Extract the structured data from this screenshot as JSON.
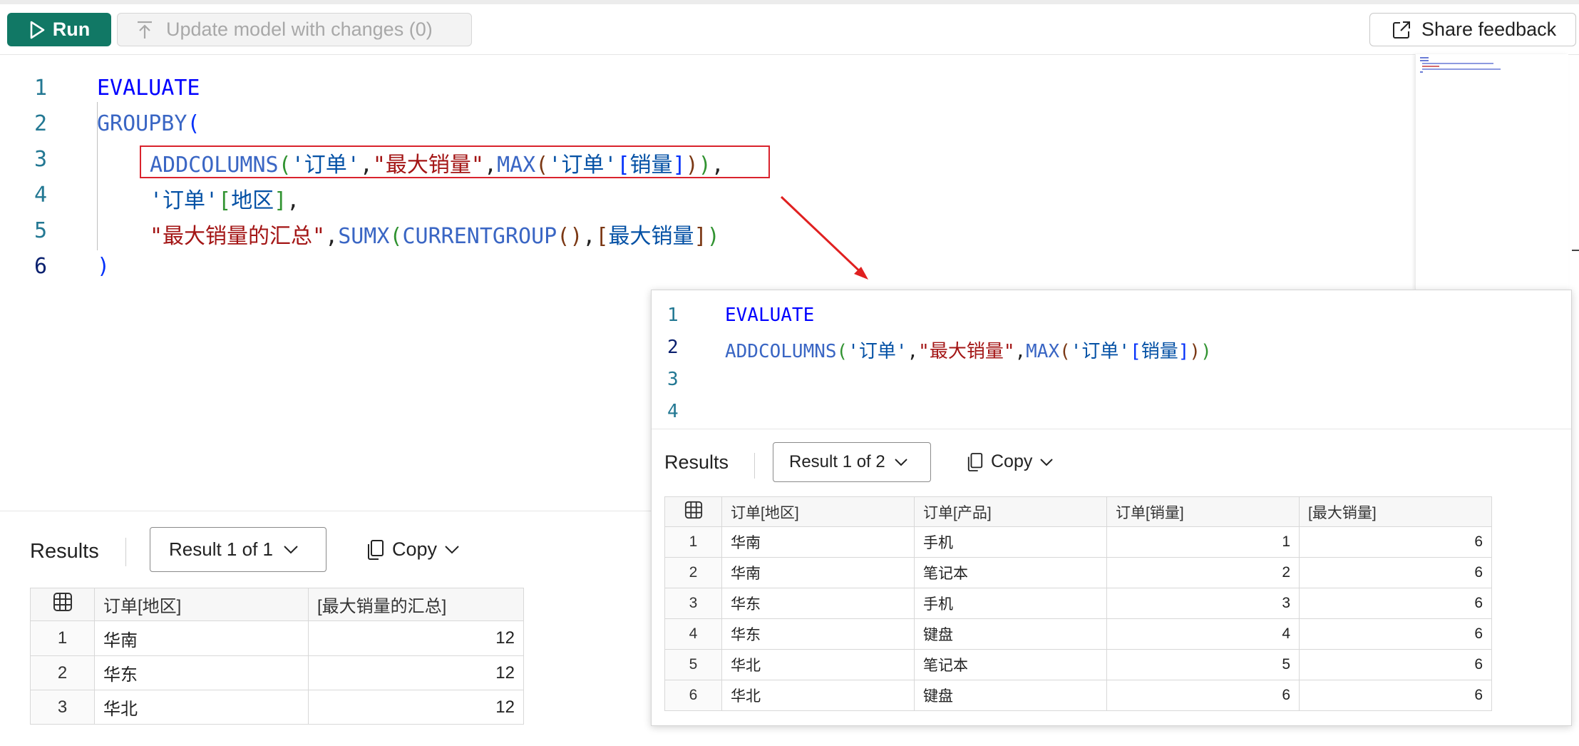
{
  "toolbar": {
    "run_label": "Run",
    "update_label": "Update model with changes (0)",
    "feedback_label": "Share feedback"
  },
  "editor": {
    "line_numbers": [
      "1",
      "2",
      "3",
      "4",
      "5",
      "6"
    ],
    "lines": [
      {
        "t1": "EVALUATE"
      },
      {
        "t1": "GROUPBY",
        "t2": "("
      },
      {
        "t1": "ADDCOLUMNS",
        "t2": "(",
        "t3": "'订单'",
        "t4": ",",
        "t5": "\"最大销量\"",
        "t6": ",",
        "t7": "MAX",
        "t8": "(",
        "t9": "'订单'",
        "t10": "[",
        "t11": "销量",
        "t12": "]",
        "t13": ")",
        "t14": ")",
        "t15": ","
      },
      {
        "t1": "'订单'",
        "t2": "[",
        "t3": "地区",
        "t4": "]",
        "t5": ","
      },
      {
        "t1": "\"最大销量的汇总\"",
        "t2": ",",
        "t3": "SUMX",
        "t4": "(",
        "t5": "CURRENTGROUP",
        "t6": "(",
        "t7": ")",
        "t8": ",",
        "t9": "[",
        "t10": "最大销量",
        "t11": "]",
        "t12": ")"
      },
      {
        "t1": ")"
      }
    ]
  },
  "results": {
    "label": "Results",
    "result_select": "Result 1 of 1",
    "copy_label": "Copy",
    "columns": [
      "订单[地区]",
      "[最大销量的汇总]"
    ],
    "rows": [
      {
        "idx": "1",
        "region": "华南",
        "value": "12"
      },
      {
        "idx": "2",
        "region": "华东",
        "value": "12"
      },
      {
        "idx": "3",
        "region": "华北",
        "value": "12"
      }
    ]
  },
  "popup": {
    "line_numbers": [
      "1",
      "2",
      "3",
      "4"
    ],
    "lines": [
      {
        "t1": "EVALUATE"
      },
      {
        "t1": "ADDCOLUMNS",
        "t2": "(",
        "t3": "'订单'",
        "t4": ",",
        "t5": "\"最大销量\"",
        "t6": ",",
        "t7": "MAX",
        "t8": "(",
        "t9": "'订单'",
        "t10": "[",
        "t11": "销量",
        "t12": "]",
        "t13": ")",
        "t14": ")"
      }
    ],
    "results_label": "Results",
    "result_select": "Result 1 of 2",
    "copy_label": "Copy",
    "columns": [
      "订单[地区]",
      "订单[产品]",
      "订单[销量]",
      "[最大销量]"
    ],
    "rows": [
      {
        "idx": "1",
        "region": "华南",
        "product": "手机",
        "qty": "1",
        "max": "6"
      },
      {
        "idx": "2",
        "region": "华南",
        "product": "笔记本",
        "qty": "2",
        "max": "6"
      },
      {
        "idx": "3",
        "region": "华东",
        "product": "手机",
        "qty": "3",
        "max": "6"
      },
      {
        "idx": "4",
        "region": "华东",
        "product": "键盘",
        "qty": "4",
        "max": "6"
      },
      {
        "idx": "5",
        "region": "华北",
        "product": "笔记本",
        "qty": "5",
        "max": "6"
      },
      {
        "idx": "6",
        "region": "华北",
        "product": "键盘",
        "qty": "6",
        "max": "6"
      }
    ]
  },
  "colors": {
    "run_bg": "#117865",
    "keyword": "#0000ff",
    "function": "#3a66c4",
    "string": "#a31515",
    "highlight_box": "#d9232d",
    "arrow": "#e02020"
  },
  "icons": [
    "play-icon",
    "upload-arrow-icon",
    "open-external-icon",
    "chevron-down-icon",
    "copy-icon",
    "grid-table-icon",
    "red-arrow-icon"
  ]
}
